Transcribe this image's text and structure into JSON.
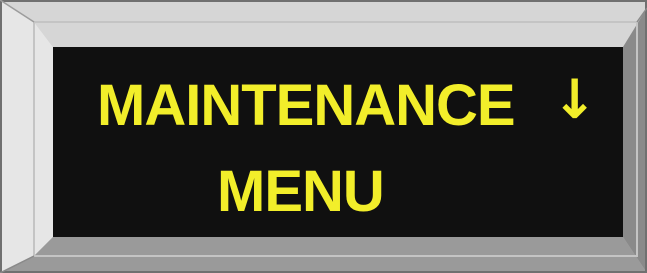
{
  "display": {
    "line1": "MAINTENANCE",
    "line2": "MENU",
    "scroll_indicator": "↓",
    "scroll_indicator_icon": "arrow-down-icon"
  },
  "colors": {
    "text": "#f2ee2a",
    "screen": "#101010",
    "bezel_face": "#c8c8c8",
    "bezel_dark": "#7d7d7d",
    "bezel_light": "#ececec"
  }
}
